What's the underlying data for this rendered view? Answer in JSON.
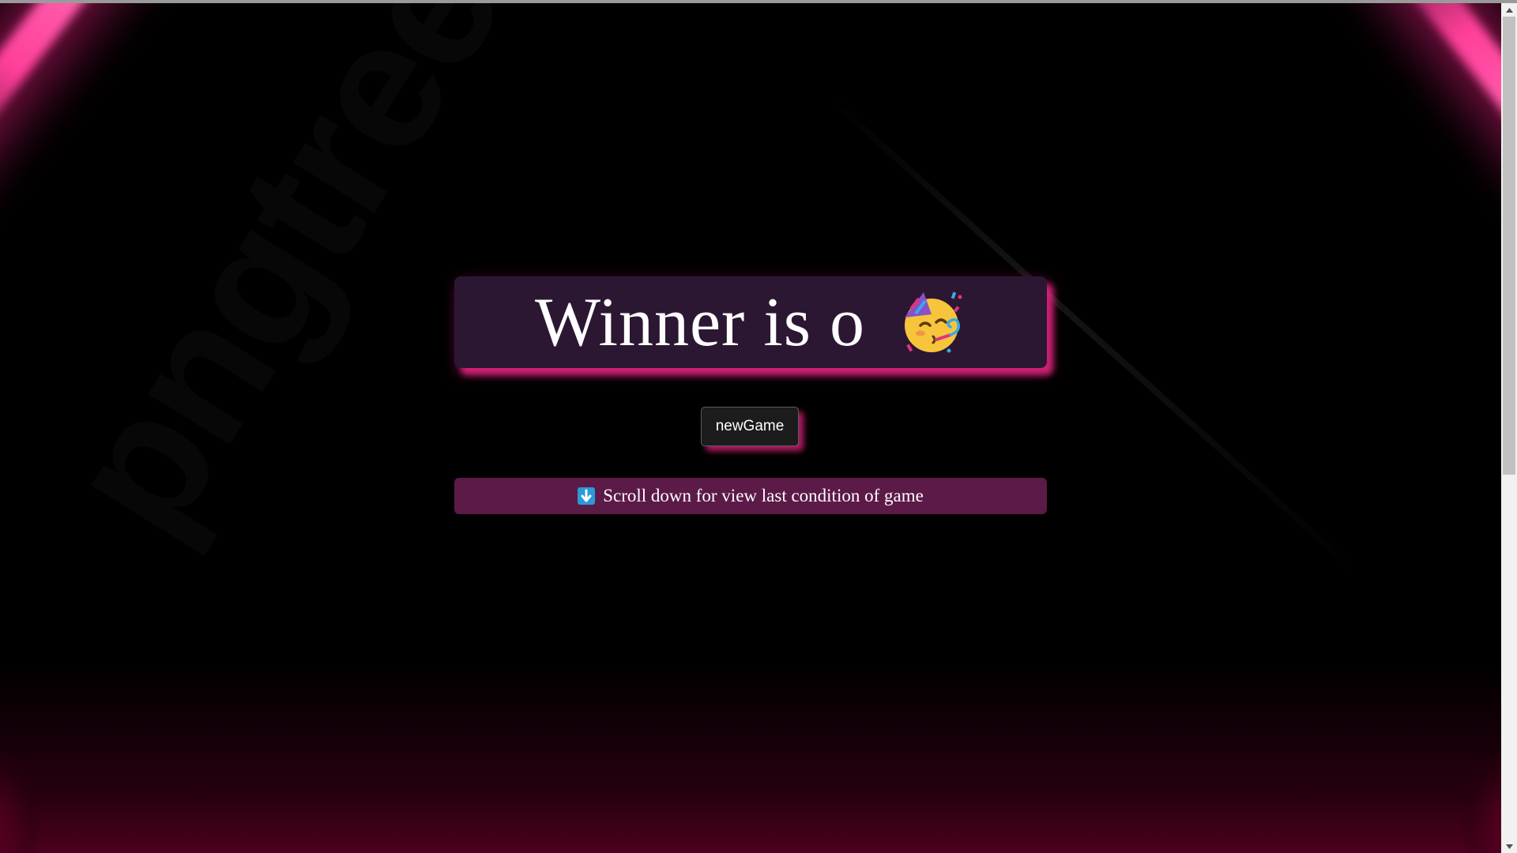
{
  "winner": {
    "text": "Winner is o",
    "emoji_icon": "partying-face-icon"
  },
  "controls": {
    "new_game_label": "newGame"
  },
  "hint": {
    "icon": "down-arrow-icon",
    "text": "Scroll down for view last condition of game"
  },
  "background": {
    "watermark": "pngtree"
  },
  "colors": {
    "accent_pink": "#ff3f9a",
    "winner_box": "#2c1733",
    "hint_bar": "#5c1a48",
    "background": "#000000"
  }
}
